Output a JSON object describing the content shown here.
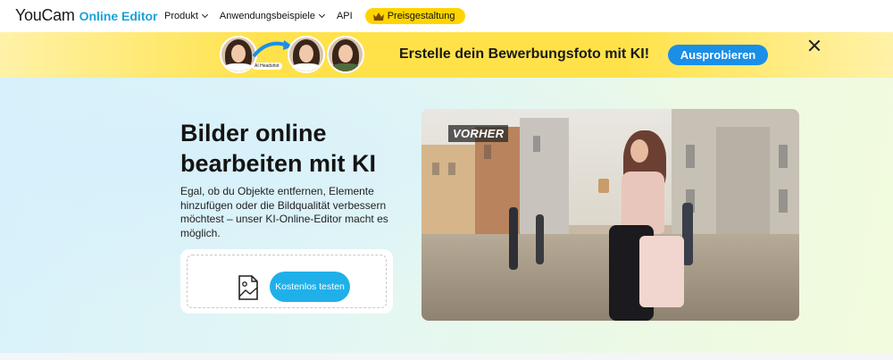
{
  "nav": {
    "logo_main": "YouCam",
    "logo_sub": "Online Editor",
    "items": [
      {
        "label": "Produkt"
      },
      {
        "label": "Anwendungsbeispiele"
      },
      {
        "label": "API"
      }
    ],
    "pricing_label": "Preisgestaltung",
    "accent": "#ffd400"
  },
  "banner": {
    "ai_tag": "AI Headshot",
    "title": "Erstelle dein Bewerbungsfoto mit KI!",
    "button_label": "Ausprobieren",
    "button_color": "#1a8fe8"
  },
  "hero": {
    "title": "Bilder online bearbeiten mit KI",
    "description": "Egal, ob du Objekte entfernen, Elemente hinzufügen oder die Bildqualität verbessern möchtest – unser KI-Online-Editor macht es möglich.",
    "cta_label": "Kostenlos testen",
    "cta_color": "#1fb0ea",
    "photo_tag": "VORHER"
  }
}
